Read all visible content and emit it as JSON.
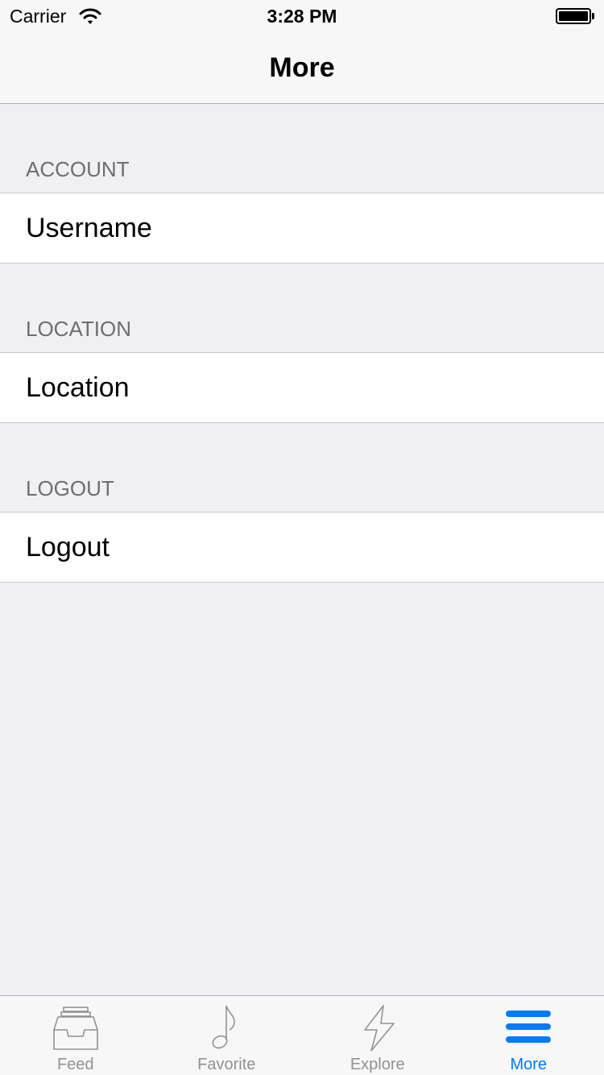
{
  "status_bar": {
    "carrier": "Carrier",
    "time": "3:28 PM",
    "battery_level": 1.0
  },
  "nav": {
    "title": "More"
  },
  "sections": [
    {
      "header": "ACCOUNT",
      "cell": "Username"
    },
    {
      "header": "LOCATION",
      "cell": "Location"
    },
    {
      "header": "LOGOUT",
      "cell": "Logout"
    }
  ],
  "tabbar": {
    "items": [
      {
        "label": "Feed",
        "icon": "inbox-tray-icon",
        "active": false
      },
      {
        "label": "Favorite",
        "icon": "music-note-icon",
        "active": false
      },
      {
        "label": "Explore",
        "icon": "lightning-bolt-icon",
        "active": false
      },
      {
        "label": "More",
        "icon": "menu-bars-icon",
        "active": true
      }
    ]
  },
  "colors": {
    "accent": "#007aff",
    "inactive_tab": "#929292",
    "section_header_text": "#6d6d72",
    "grouped_background": "#efeff4"
  }
}
